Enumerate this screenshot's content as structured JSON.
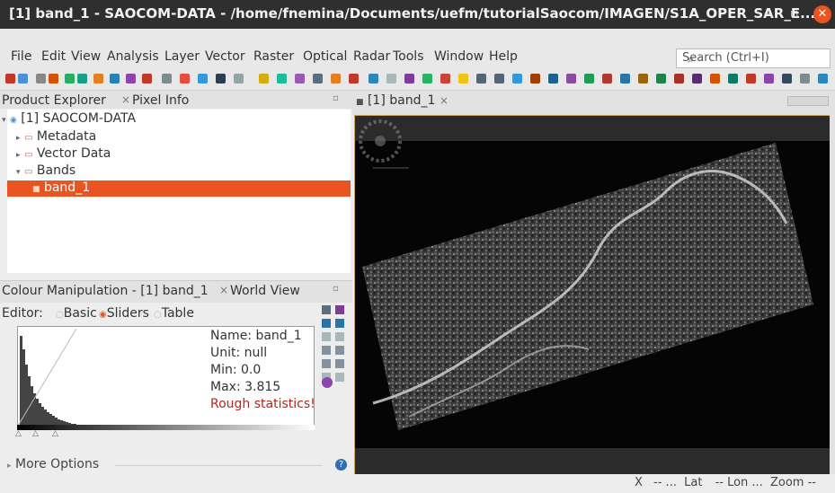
{
  "window": {
    "title": "[1] band_1 - SAOCOM-DATA - /home/fnemina/Documents/uefm/tutorialSaocom/IMAGEN/S1A_OPER_SAR_E...",
    "min_glyph": "–",
    "max_glyph": "▫",
    "close_glyph": "✕"
  },
  "menu": {
    "items": [
      "File",
      "Edit",
      "View",
      "Analysis",
      "Layer",
      "Vector",
      "Raster",
      "Optical",
      "Radar",
      "Tools",
      "Window",
      "Help"
    ]
  },
  "search": {
    "placeholder": "Search (Ctrl+I)",
    "icon": "search-icon"
  },
  "product_explorer": {
    "tab_label": "Product Explorer",
    "tab_close": "×",
    "pixel_info_tab": "Pixel Info",
    "tree": {
      "root": "[1] SAOCOM-DATA",
      "metadata": "Metadata",
      "vector_data": "Vector Data",
      "bands": "Bands",
      "band": "band_1"
    }
  },
  "viewer": {
    "tab_label": "[1] band_1",
    "tab_close": "×"
  },
  "colour_manipulation": {
    "tab_label": "Colour Manipulation - [1] band_1",
    "tab_close": "×",
    "world_view_tab": "World View",
    "editor_label": "Editor:",
    "modes": [
      "Basic",
      "Sliders",
      "Table"
    ],
    "selected_mode": "Sliders",
    "stats": {
      "name": "Name: band_1",
      "unit": "Unit: null",
      "min": "Min: 0.0",
      "max": "Max: 3.815",
      "warning": "Rough statistics!"
    },
    "more_options": "More Options"
  },
  "status": {
    "x": "X",
    "x_val": "-- ...",
    "lat": "Lat",
    "lon_val": "-- Lon ...",
    "zoom": "Zoom --"
  },
  "colors": {
    "accent": "#e95420",
    "titlebar": "#2f2f2f",
    "viewer_border": "#c9a85a",
    "warning": "#b3261e"
  }
}
